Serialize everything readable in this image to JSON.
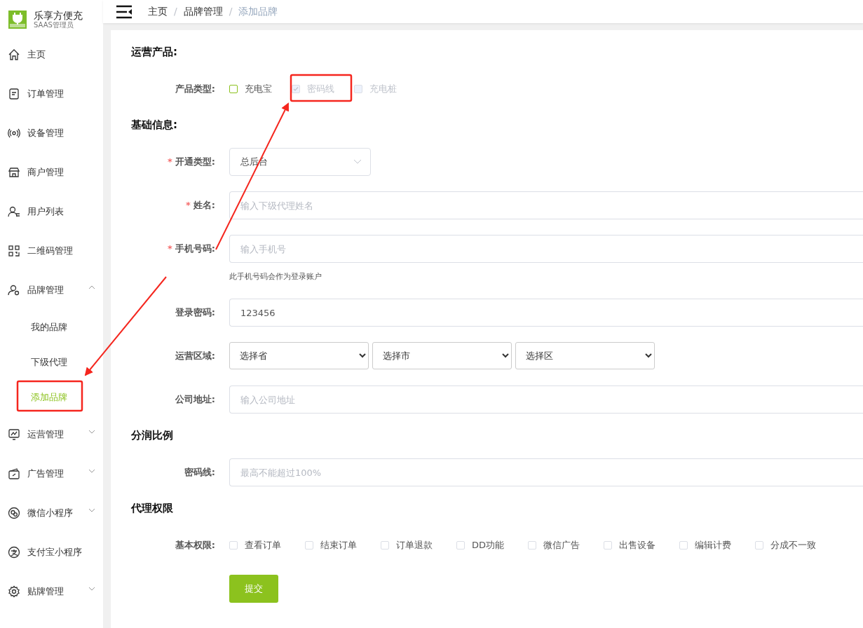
{
  "brand": {
    "name": "乐享方便充",
    "subtitle": "SAAS管理员"
  },
  "sidebar": {
    "items": [
      {
        "label": "主页",
        "expandable": false
      },
      {
        "label": "订单管理",
        "expandable": false
      },
      {
        "label": "设备管理",
        "expandable": false
      },
      {
        "label": "商户管理",
        "expandable": false
      },
      {
        "label": "用户列表",
        "expandable": false
      },
      {
        "label": "二维码管理",
        "expandable": false
      },
      {
        "label": "品牌管理",
        "expandable": true,
        "expanded": true,
        "children": [
          {
            "label": "我的品牌",
            "selected": false
          },
          {
            "label": "下级代理",
            "selected": false
          },
          {
            "label": "添加品牌",
            "selected": true
          }
        ]
      },
      {
        "label": "运营管理",
        "expandable": true,
        "expanded": false
      },
      {
        "label": "广告管理",
        "expandable": true,
        "expanded": false
      },
      {
        "label": "微信小程序",
        "expandable": true,
        "expanded": false
      },
      {
        "label": "支付宝小程序",
        "expandable": false
      },
      {
        "label": "贴牌管理",
        "expandable": true,
        "expanded": false
      }
    ]
  },
  "breadcrumb": [
    {
      "label": "主页",
      "current": false
    },
    {
      "label": "品牌管理",
      "current": false
    },
    {
      "label": "添加品牌",
      "current": true
    }
  ],
  "breadcrumb_separator": "/",
  "required_mark": "*",
  "sections": [
    {
      "title": "运营产品:",
      "rows": [
        {
          "kind": "checkboxes",
          "label": "产品类型:",
          "required": false,
          "options": [
            {
              "label": "充电宝",
              "checked": false,
              "disabled": false,
              "focused": true
            },
            {
              "label": "密码线",
              "checked": true,
              "disabled": true
            },
            {
              "label": "充电桩",
              "checked": false,
              "disabled": true
            }
          ]
        }
      ]
    },
    {
      "title": "基础信息:",
      "rows": [
        {
          "kind": "dropdown",
          "label": "开通类型:",
          "required": true,
          "value": "总后台"
        },
        {
          "kind": "input",
          "label": "姓名:",
          "required": true,
          "placeholder": "输入下级代理姓名"
        },
        {
          "kind": "input",
          "label": "手机号码:",
          "required": true,
          "placeholder": "输入手机号",
          "hint": "此手机号码会作为登录账户"
        },
        {
          "kind": "input",
          "label": "登录密码:",
          "required": false,
          "value": "123456"
        },
        {
          "kind": "selects",
          "label": "运营区域:",
          "required": false,
          "options": [
            "选择省",
            "选择市",
            "选择区"
          ]
        },
        {
          "kind": "input",
          "label": "公司地址:",
          "required": false,
          "placeholder": "输入公司地址"
        }
      ]
    },
    {
      "title": "分润比例",
      "rows": [
        {
          "kind": "input",
          "label": "密码线:",
          "required": false,
          "placeholder": "最高不能超过100%"
        }
      ]
    },
    {
      "title": "代理权限",
      "rows": [
        {
          "kind": "checkboxes",
          "label": "基本权限:",
          "required": false,
          "options": [
            {
              "label": "查看订单",
              "checked": false,
              "disabled": false,
              "focused": false
            },
            {
              "label": "结束订单",
              "checked": false,
              "disabled": false,
              "focused": false
            },
            {
              "label": "订单退款",
              "checked": false,
              "disabled": false,
              "focused": false
            },
            {
              "label": "DD功能",
              "checked": false,
              "disabled": false,
              "focused": false
            },
            {
              "label": "微信广告",
              "checked": false,
              "disabled": false,
              "focused": false
            },
            {
              "label": "出售设备",
              "checked": false,
              "disabled": false,
              "focused": false
            },
            {
              "label": "编辑计费",
              "checked": false,
              "disabled": false,
              "focused": false
            },
            {
              "label": "分成不一致",
              "checked": false,
              "disabled": false,
              "focused": false
            }
          ]
        }
      ]
    }
  ],
  "submit": "提交"
}
